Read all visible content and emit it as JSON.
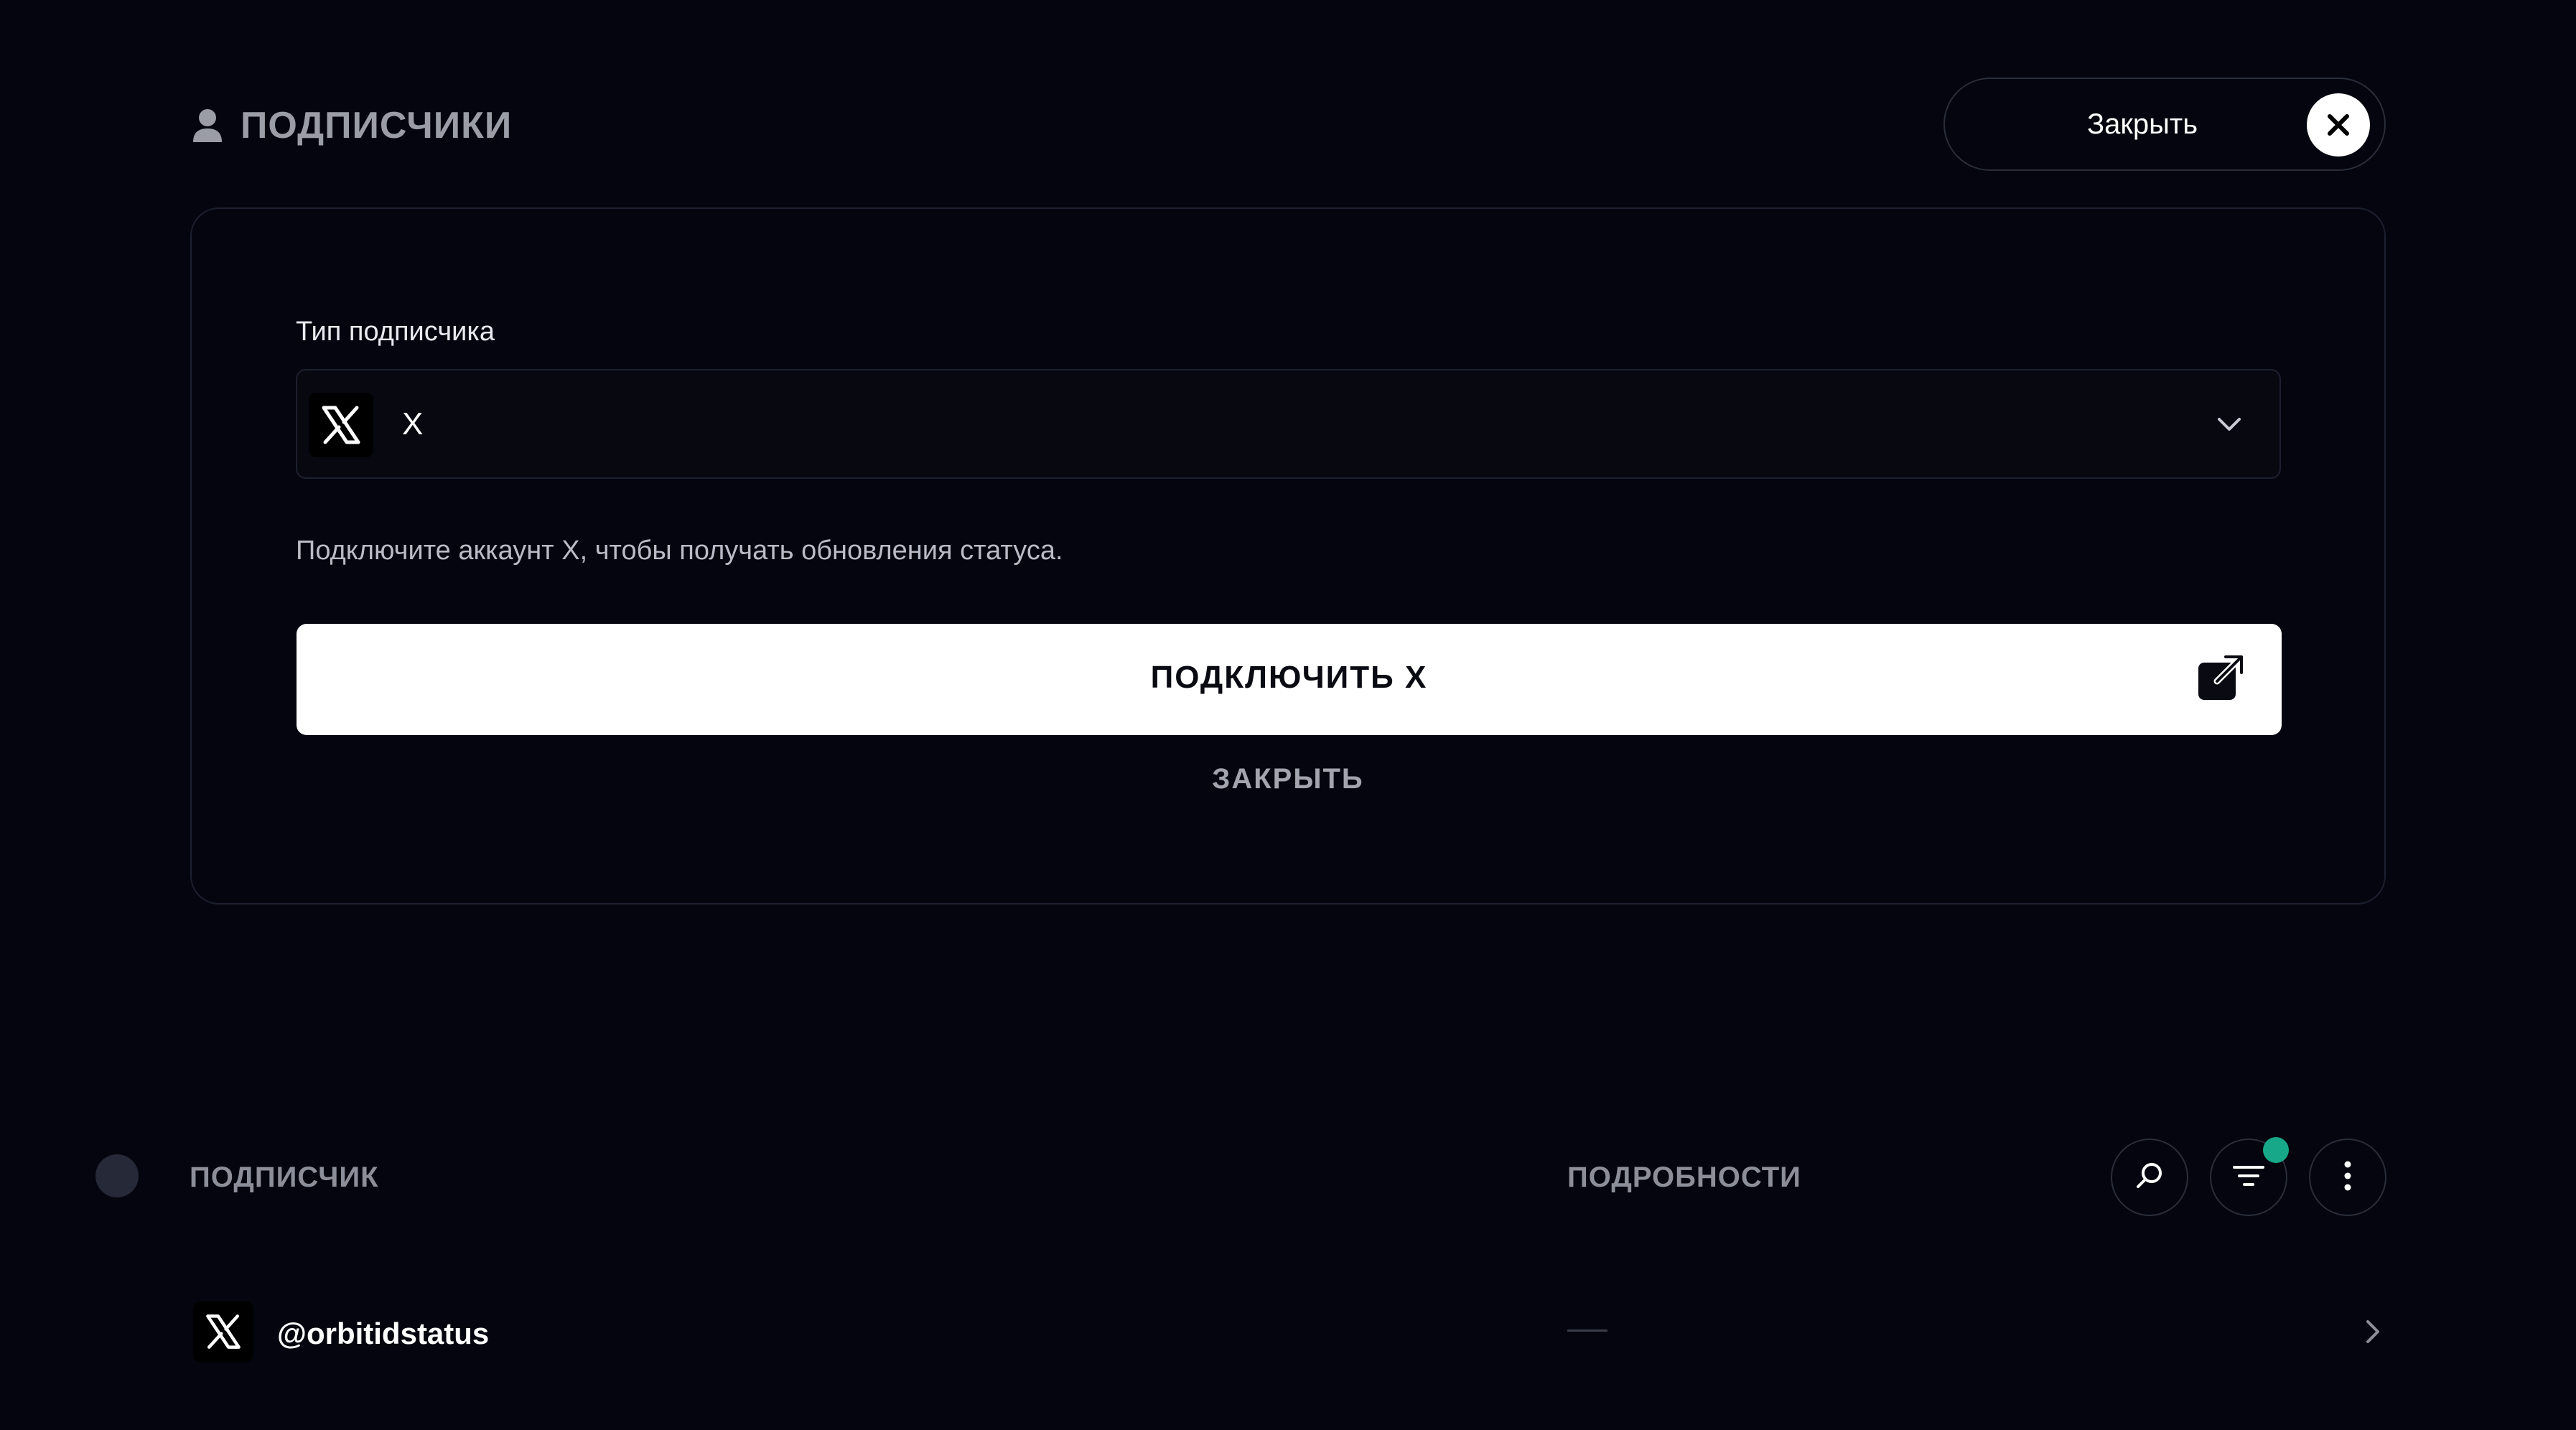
{
  "header": {
    "title": "ПОДПИСЧИКИ",
    "close_label": "Закрыть"
  },
  "form": {
    "field_label": "Тип подписчика",
    "selected_value": "X",
    "helper_text": "Подключите аккаунт X, чтобы получать обновления статуса.",
    "connect_label": "ПОДКЛЮЧИТЬ X",
    "cancel_label": "ЗАКРЫТЬ"
  },
  "table": {
    "columns": [
      "ПОДПИСЧИК",
      "ПОДРОБНОСТИ"
    ],
    "filter_active": true,
    "rows": [
      {
        "handle": "@orbitidstatus",
        "details": ""
      }
    ]
  },
  "colors": {
    "background": "#04050e",
    "accent_badge": "#17a88a"
  },
  "icons": [
    "user-icon",
    "close-icon",
    "x-logo-icon",
    "chevron-down-icon",
    "external-link-icon",
    "search-icon",
    "filter-icon",
    "more-vertical-icon",
    "chevron-right-icon"
  ]
}
